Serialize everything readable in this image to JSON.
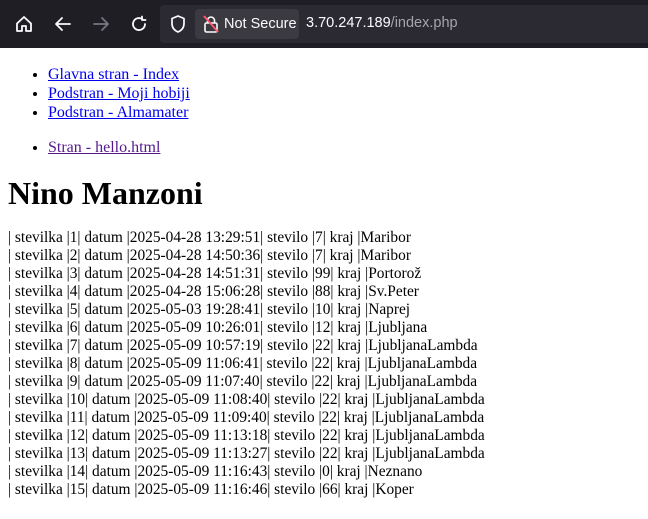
{
  "browser": {
    "security_label": "Not Secure",
    "url_host": "3.70.247.189",
    "url_path": "/index.php"
  },
  "nav_links": [
    {
      "label": "Glavna stran - Index"
    },
    {
      "label": "Podstran - Moji hobiji"
    },
    {
      "label": "Podstran - Almamater"
    }
  ],
  "extra_links": [
    {
      "label": "Stran - hello.html"
    }
  ],
  "heading": "Nino Manzoni",
  "rows": [
    "| stevilka |1| datum |2025-04-28 13:29:51| stevilo |7| kraj |Maribor",
    "| stevilka |2| datum |2025-04-28 14:50:36| stevilo |7| kraj |Maribor",
    "| stevilka |3| datum |2025-04-28 14:51:31| stevilo |99| kraj |Portorož",
    "| stevilka |4| datum |2025-04-28 15:06:28| stevilo |88| kraj |Sv.Peter",
    "| stevilka |5| datum |2025-05-03 19:28:41| stevilo |10| kraj |Naprej",
    "| stevilka |6| datum |2025-05-09 10:26:01| stevilo |12| kraj |Ljubljana",
    "| stevilka |7| datum |2025-05-09 10:57:19| stevilo |22| kraj |LjubljanaLambda",
    "| stevilka |8| datum |2025-05-09 11:06:41| stevilo |22| kraj |LjubljanaLambda",
    "| stevilka |9| datum |2025-05-09 11:07:40| stevilo |22| kraj |LjubljanaLambda",
    "| stevilka |10| datum |2025-05-09 11:08:40| stevilo |22| kraj |LjubljanaLambda",
    "| stevilka |11| datum |2025-05-09 11:09:40| stevilo |22| kraj |LjubljanaLambda",
    "| stevilka |12| datum |2025-05-09 11:13:18| stevilo |22| kraj |LjubljanaLambda",
    "| stevilka |13| datum |2025-05-09 11:13:27| stevilo |22| kraj |LjubljanaLambda",
    "| stevilka |14| datum |2025-05-09 11:16:43| stevilo |0| kraj |Neznano",
    "| stevilka |15| datum |2025-05-09 11:16:46| stevilo |66| kraj |Koper"
  ]
}
